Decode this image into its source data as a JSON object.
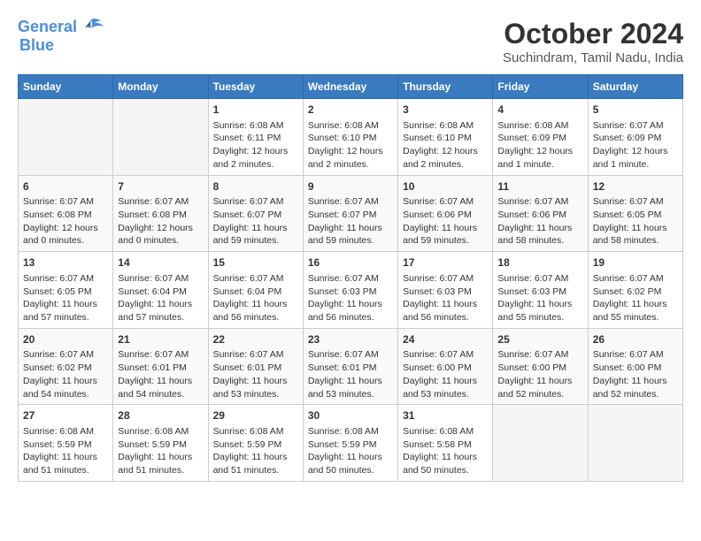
{
  "logo": {
    "line1": "General",
    "line2": "Blue"
  },
  "title": "October 2024",
  "location": "Suchindram, Tamil Nadu, India",
  "days_of_week": [
    "Sunday",
    "Monday",
    "Tuesday",
    "Wednesday",
    "Thursday",
    "Friday",
    "Saturday"
  ],
  "weeks": [
    [
      {
        "day": "",
        "info": ""
      },
      {
        "day": "",
        "info": ""
      },
      {
        "day": "1",
        "info": "Sunrise: 6:08 AM\nSunset: 6:11 PM\nDaylight: 12 hours\nand 2 minutes."
      },
      {
        "day": "2",
        "info": "Sunrise: 6:08 AM\nSunset: 6:10 PM\nDaylight: 12 hours\nand 2 minutes."
      },
      {
        "day": "3",
        "info": "Sunrise: 6:08 AM\nSunset: 6:10 PM\nDaylight: 12 hours\nand 2 minutes."
      },
      {
        "day": "4",
        "info": "Sunrise: 6:08 AM\nSunset: 6:09 PM\nDaylight: 12 hours\nand 1 minute."
      },
      {
        "day": "5",
        "info": "Sunrise: 6:07 AM\nSunset: 6:09 PM\nDaylight: 12 hours\nand 1 minute."
      }
    ],
    [
      {
        "day": "6",
        "info": "Sunrise: 6:07 AM\nSunset: 6:08 PM\nDaylight: 12 hours\nand 0 minutes."
      },
      {
        "day": "7",
        "info": "Sunrise: 6:07 AM\nSunset: 6:08 PM\nDaylight: 12 hours\nand 0 minutes."
      },
      {
        "day": "8",
        "info": "Sunrise: 6:07 AM\nSunset: 6:07 PM\nDaylight: 11 hours\nand 59 minutes."
      },
      {
        "day": "9",
        "info": "Sunrise: 6:07 AM\nSunset: 6:07 PM\nDaylight: 11 hours\nand 59 minutes."
      },
      {
        "day": "10",
        "info": "Sunrise: 6:07 AM\nSunset: 6:06 PM\nDaylight: 11 hours\nand 59 minutes."
      },
      {
        "day": "11",
        "info": "Sunrise: 6:07 AM\nSunset: 6:06 PM\nDaylight: 11 hours\nand 58 minutes."
      },
      {
        "day": "12",
        "info": "Sunrise: 6:07 AM\nSunset: 6:05 PM\nDaylight: 11 hours\nand 58 minutes."
      }
    ],
    [
      {
        "day": "13",
        "info": "Sunrise: 6:07 AM\nSunset: 6:05 PM\nDaylight: 11 hours\nand 57 minutes."
      },
      {
        "day": "14",
        "info": "Sunrise: 6:07 AM\nSunset: 6:04 PM\nDaylight: 11 hours\nand 57 minutes."
      },
      {
        "day": "15",
        "info": "Sunrise: 6:07 AM\nSunset: 6:04 PM\nDaylight: 11 hours\nand 56 minutes."
      },
      {
        "day": "16",
        "info": "Sunrise: 6:07 AM\nSunset: 6:03 PM\nDaylight: 11 hours\nand 56 minutes."
      },
      {
        "day": "17",
        "info": "Sunrise: 6:07 AM\nSunset: 6:03 PM\nDaylight: 11 hours\nand 56 minutes."
      },
      {
        "day": "18",
        "info": "Sunrise: 6:07 AM\nSunset: 6:03 PM\nDaylight: 11 hours\nand 55 minutes."
      },
      {
        "day": "19",
        "info": "Sunrise: 6:07 AM\nSunset: 6:02 PM\nDaylight: 11 hours\nand 55 minutes."
      }
    ],
    [
      {
        "day": "20",
        "info": "Sunrise: 6:07 AM\nSunset: 6:02 PM\nDaylight: 11 hours\nand 54 minutes."
      },
      {
        "day": "21",
        "info": "Sunrise: 6:07 AM\nSunset: 6:01 PM\nDaylight: 11 hours\nand 54 minutes."
      },
      {
        "day": "22",
        "info": "Sunrise: 6:07 AM\nSunset: 6:01 PM\nDaylight: 11 hours\nand 53 minutes."
      },
      {
        "day": "23",
        "info": "Sunrise: 6:07 AM\nSunset: 6:01 PM\nDaylight: 11 hours\nand 53 minutes."
      },
      {
        "day": "24",
        "info": "Sunrise: 6:07 AM\nSunset: 6:00 PM\nDaylight: 11 hours\nand 53 minutes."
      },
      {
        "day": "25",
        "info": "Sunrise: 6:07 AM\nSunset: 6:00 PM\nDaylight: 11 hours\nand 52 minutes."
      },
      {
        "day": "26",
        "info": "Sunrise: 6:07 AM\nSunset: 6:00 PM\nDaylight: 11 hours\nand 52 minutes."
      }
    ],
    [
      {
        "day": "27",
        "info": "Sunrise: 6:08 AM\nSunset: 5:59 PM\nDaylight: 11 hours\nand 51 minutes."
      },
      {
        "day": "28",
        "info": "Sunrise: 6:08 AM\nSunset: 5:59 PM\nDaylight: 11 hours\nand 51 minutes."
      },
      {
        "day": "29",
        "info": "Sunrise: 6:08 AM\nSunset: 5:59 PM\nDaylight: 11 hours\nand 51 minutes."
      },
      {
        "day": "30",
        "info": "Sunrise: 6:08 AM\nSunset: 5:59 PM\nDaylight: 11 hours\nand 50 minutes."
      },
      {
        "day": "31",
        "info": "Sunrise: 6:08 AM\nSunset: 5:58 PM\nDaylight: 11 hours\nand 50 minutes."
      },
      {
        "day": "",
        "info": ""
      },
      {
        "day": "",
        "info": ""
      }
    ]
  ]
}
